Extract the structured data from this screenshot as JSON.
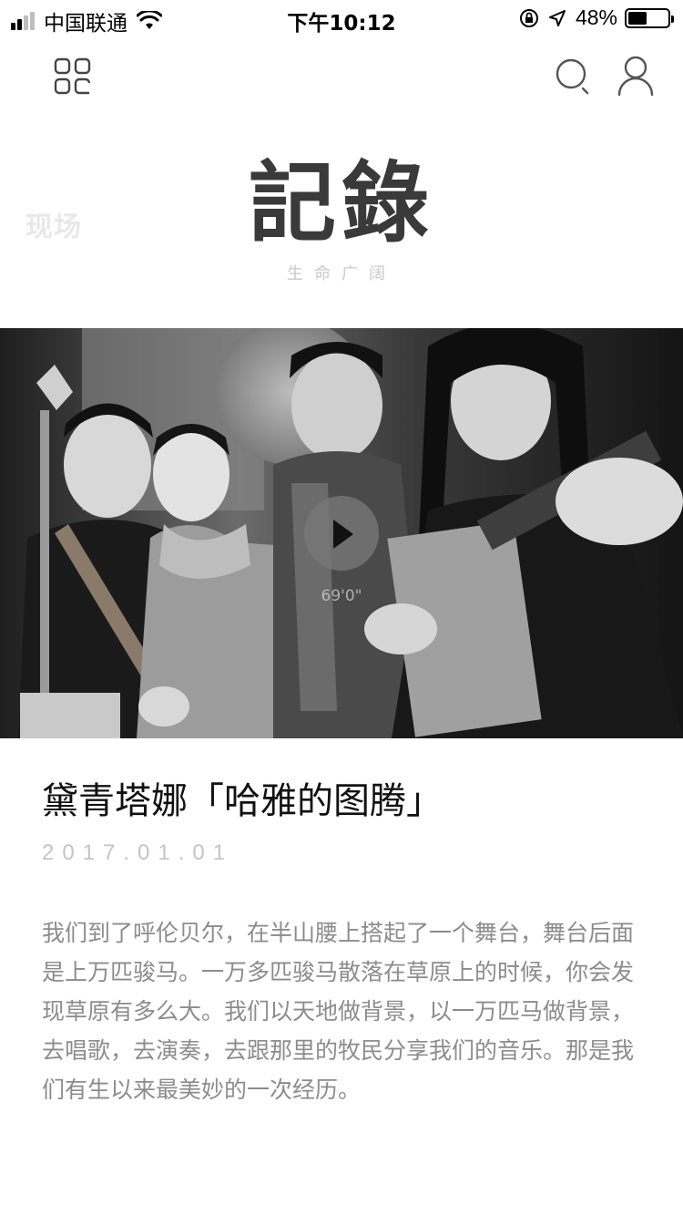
{
  "status_bar": {
    "carrier": "中国联通",
    "time": "下午10:12",
    "battery_percent": "48%",
    "battery_level": 0.48,
    "signal_bars_on": 2,
    "signal_bars_total": 4
  },
  "nav": {
    "menu_icon": "grid-menu-icon",
    "search_icon": "search-icon",
    "user_icon": "user-icon"
  },
  "header": {
    "side_label": "现场",
    "brand_title": "記錄",
    "brand_subtitle": "生命广阔"
  },
  "hero": {
    "play_icon": "play-icon",
    "duration": "69'0\""
  },
  "article": {
    "title": "黛青塔娜「哈雅的图腾」",
    "date": "2017.01.01",
    "body": "我们到了呼伦贝尔，在半山腰上搭起了一个舞台，舞台后面是上万匹骏马。一万多匹骏马散落在草原上的时候，你会发现草原有多么大。我们以天地做背景，以一万匹马做背景，去唱歌，去演奏，去跟那里的牧民分享我们的音乐。那是我们有生以来最美妙的一次经历。"
  },
  "colors": {
    "title": "#111111",
    "date": "#c4c4c4",
    "body": "#8c8c8c",
    "brand": "#3a3a3a"
  }
}
